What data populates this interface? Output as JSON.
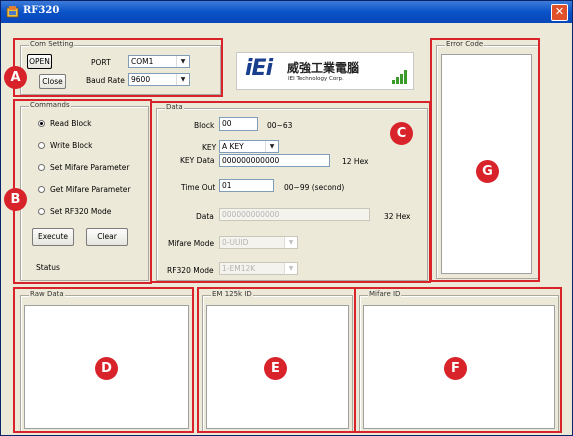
{
  "window": {
    "title": "RF320",
    "close_glyph": "✕"
  },
  "com_setting": {
    "group_label": "Com Setting",
    "open_label": "OPEN",
    "close_label": "Close",
    "port_label": "PORT",
    "port_value": "COM1",
    "baud_label": "Baud Rate",
    "baud_value": "9600"
  },
  "logo": {
    "brand": "iEi",
    "chinese": "威強工業電腦",
    "english": "IEI Technology Corp."
  },
  "commands": {
    "group_label": "Commands",
    "options": [
      "Read Block",
      "Write Block",
      "Set Mifare Parameter",
      "Get Mifare Parameter",
      "Set RF320 Mode"
    ],
    "selected_index": 0,
    "execute_label": "Execute",
    "clear_label": "Clear",
    "status_label": "Status"
  },
  "data_panel": {
    "group_label": "Data",
    "block_label": "Block",
    "block_value": "00",
    "block_hint": "00~63",
    "key_label": "KEY",
    "key_value": "A KEY",
    "key_data_label": "KEY Data",
    "key_data_value": "000000000000",
    "key_data_hint": "12 Hex",
    "timeout_label": "Time Out",
    "timeout_value": "01",
    "timeout_hint": "00~99 (second)",
    "data_label": "Data",
    "data_value": "000000000000",
    "data_hint": "32 Hex",
    "mifare_mode_label": "Mifare Mode",
    "mifare_mode_value": "0-UUID",
    "rf320_mode_label": "RF320 Mode",
    "rf320_mode_value": "1-EM12K"
  },
  "error_code": {
    "group_label": "Error Code"
  },
  "raw_data": {
    "group_label": "Raw Data"
  },
  "em_id": {
    "group_label": "EM 125k ID"
  },
  "mifare_id": {
    "group_label": "Mifare ID"
  },
  "callouts": [
    "A",
    "B",
    "C",
    "D",
    "E",
    "F",
    "G"
  ],
  "colors": {
    "callout": "#d8232a",
    "title_bar": "#0a53c8",
    "dialog_bg": "#ece9d8"
  }
}
